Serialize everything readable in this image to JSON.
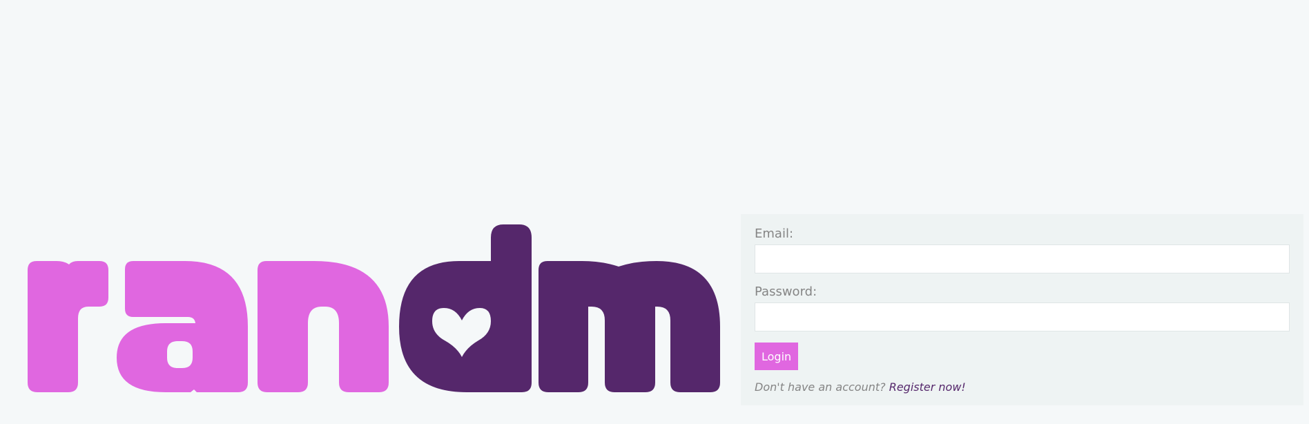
{
  "brand": {
    "logo_text": "randm",
    "part_one": "ran",
    "part_two": "dm",
    "pink": "#e067e0",
    "purple": "#55276b",
    "icon": "heart-icon"
  },
  "login": {
    "email_label": "Email:",
    "email_value": "",
    "password_label": "Password:",
    "password_value": "",
    "login_button": "Login",
    "register_prompt": "Don't have an account?",
    "register_link": "Register now!"
  }
}
